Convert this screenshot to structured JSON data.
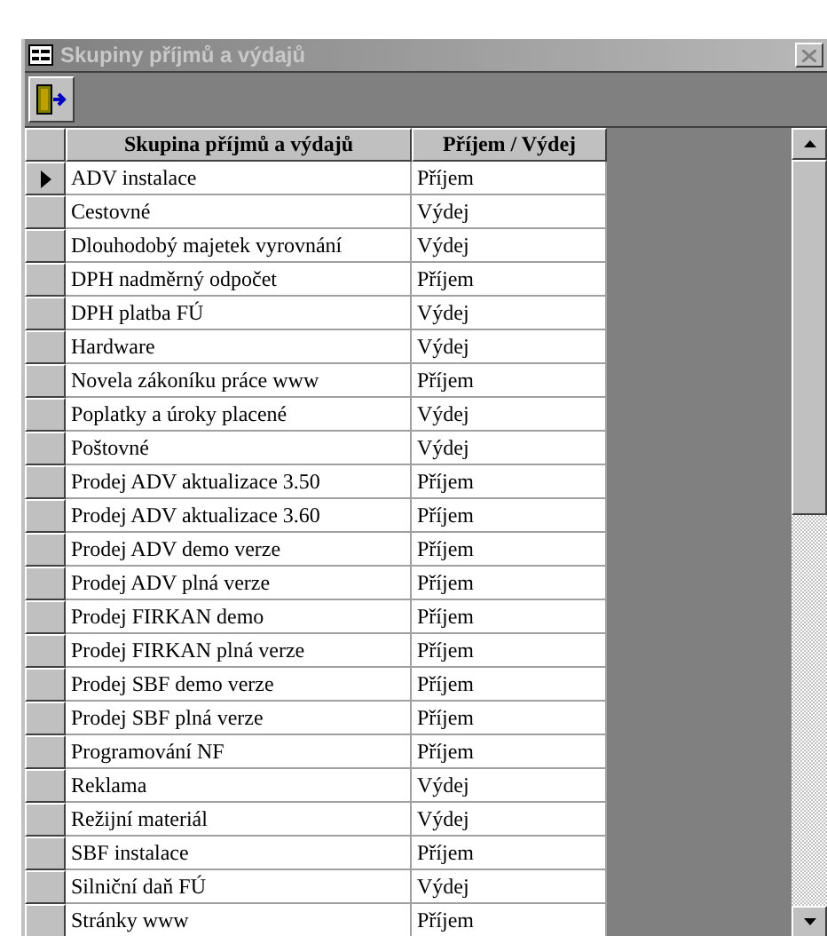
{
  "window": {
    "title": "Skupiny příjmů a výdajů"
  },
  "table": {
    "columns": [
      "Skupina příjmů a výdajů",
      "Příjem / Výdej"
    ],
    "rows": [
      {
        "name": "ADV instalace",
        "type": "Příjem",
        "selected": true
      },
      {
        "name": "Cestovné",
        "type": "Výdej",
        "selected": false
      },
      {
        "name": "Dlouhodobý majetek vyrovnání",
        "type": "Výdej",
        "selected": false
      },
      {
        "name": "DPH nadměrný odpočet",
        "type": "Příjem",
        "selected": false
      },
      {
        "name": "DPH platba FÚ",
        "type": "Výdej",
        "selected": false
      },
      {
        "name": "Hardware",
        "type": "Výdej",
        "selected": false
      },
      {
        "name": "Novela zákoníku práce www",
        "type": "Příjem",
        "selected": false
      },
      {
        "name": "Poplatky a úroky placené",
        "type": "Výdej",
        "selected": false
      },
      {
        "name": "Poštovné",
        "type": "Výdej",
        "selected": false
      },
      {
        "name": "Prodej ADV aktualizace 3.50",
        "type": "Příjem",
        "selected": false
      },
      {
        "name": "Prodej ADV aktualizace 3.60",
        "type": "Příjem",
        "selected": false
      },
      {
        "name": "Prodej ADV demo verze",
        "type": "Příjem",
        "selected": false
      },
      {
        "name": "Prodej ADV plná verze",
        "type": "Příjem",
        "selected": false
      },
      {
        "name": "Prodej FIRKAN demo",
        "type": "Příjem",
        "selected": false
      },
      {
        "name": "Prodej FIRKAN plná verze",
        "type": "Příjem",
        "selected": false
      },
      {
        "name": "Prodej SBF demo verze",
        "type": "Příjem",
        "selected": false
      },
      {
        "name": "Prodej SBF plná verze",
        "type": "Příjem",
        "selected": false
      },
      {
        "name": "Programování NF",
        "type": "Příjem",
        "selected": false
      },
      {
        "name": "Reklama",
        "type": "Výdej",
        "selected": false
      },
      {
        "name": "Režijní materiál",
        "type": "Výdej",
        "selected": false
      },
      {
        "name": "SBF instalace",
        "type": "Příjem",
        "selected": false
      },
      {
        "name": "Silniční daň FÚ",
        "type": "Výdej",
        "selected": false
      },
      {
        "name": "Stránky www",
        "type": "Příjem",
        "selected": false
      }
    ]
  }
}
